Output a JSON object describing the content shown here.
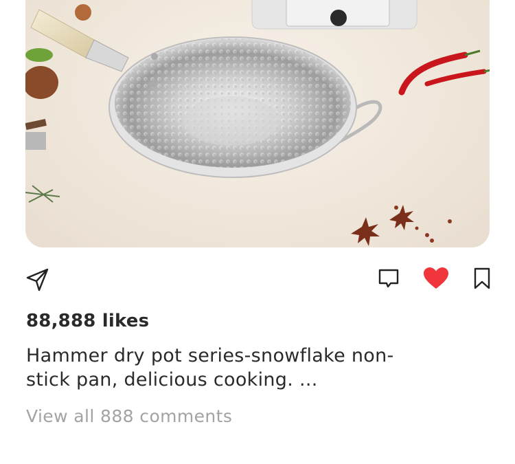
{
  "post": {
    "image_alt": "hammered stainless steel wok",
    "likes_text": "88,888 likes",
    "caption": "Hammer dry pot series-snowflake non-stick pan, delicious cooking. ...",
    "comments_link": "View all 888 comments",
    "liked": true
  },
  "icons": {
    "share": "paper-plane-icon",
    "comment": "comment-icon",
    "like": "heart-icon",
    "save": "bookmark-icon"
  },
  "colors": {
    "like_red": "#f0353c",
    "text": "#2a2a2a",
    "muted": "#a3a3a3"
  }
}
